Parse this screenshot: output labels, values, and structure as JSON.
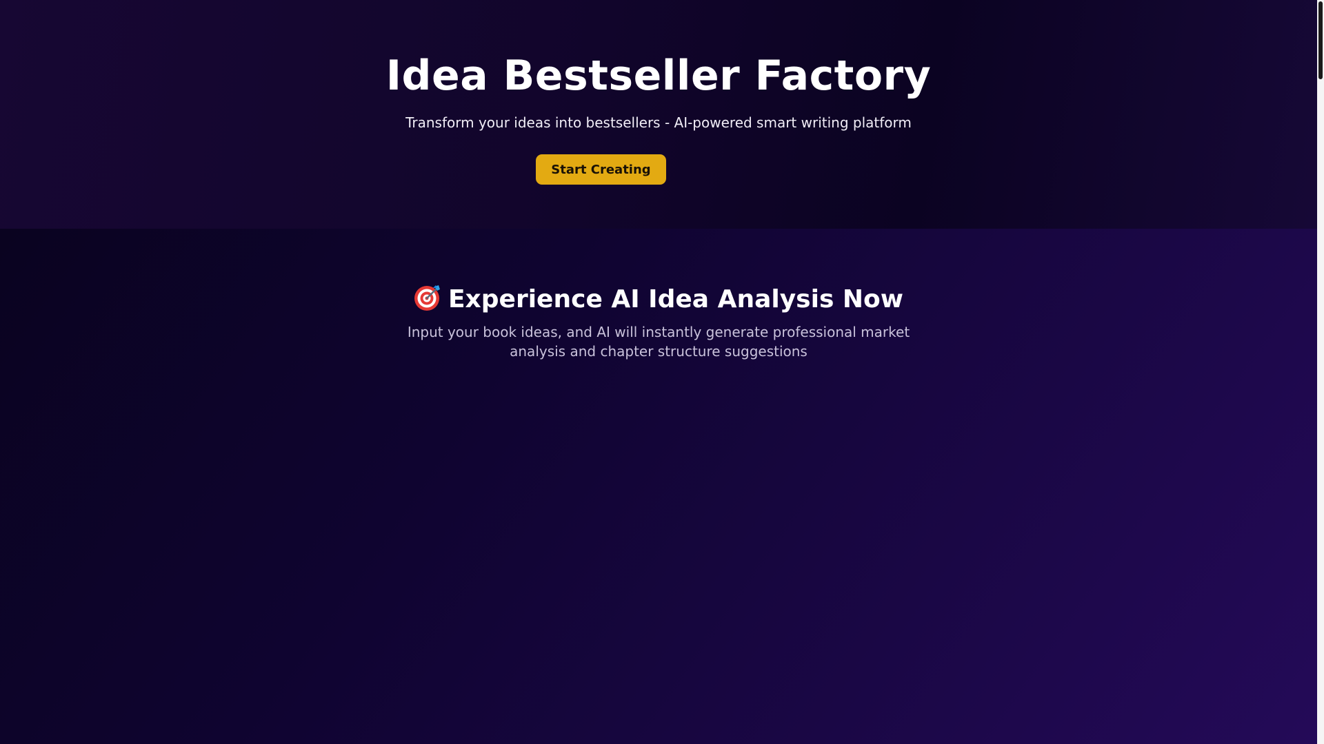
{
  "hero": {
    "title": "Idea Bestseller Factory",
    "subtitle": "Transform your ideas into bestsellers - AI-powered smart writing platform",
    "cta_label": "Start Creating"
  },
  "analysis_section": {
    "icon": "target-icon",
    "heading": "Experience AI Idea Analysis Now",
    "description": "Input your book ideas, and AI will instantly generate professional market analysis and chapter structure suggestions"
  },
  "colors": {
    "cta_background": "#e3aa12",
    "hero_background": "#11052b",
    "section_background": "#1a0745",
    "text_primary": "#ffffff"
  }
}
